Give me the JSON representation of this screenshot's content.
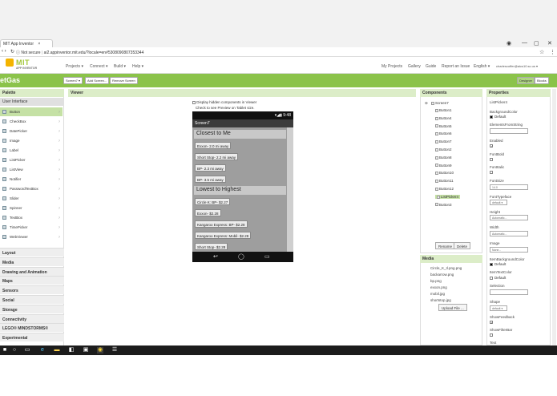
{
  "browser": {
    "tab_title": "MIT App Inventor",
    "tab_close": "×",
    "win_min": "—",
    "win_max": "▢",
    "win_close": "✕",
    "url_secure": "Not secure",
    "url": "ai2.appinventor.mit.edu/?locale=en#5308090807353344",
    "star": "☆",
    "menu": "⋮"
  },
  "appbar": {
    "logo_text": "MIT",
    "logo_sub": "APP INVENTOR",
    "menus": [
      "Projects ▾",
      "Connect ▾",
      "Build ▾",
      "Help ▾"
    ],
    "right_menus": [
      "My Projects",
      "Gallery",
      "Guide",
      "Report an Issue",
      "English ▾",
      "charlescoffer@aics10.sc.us ▾"
    ]
  },
  "toolbar": {
    "project_name": "etGas",
    "screen_btn": "Screen7 ▾",
    "add_screen": "Add Screen...",
    "remove_screen": "Remove Screen",
    "designer": "Designer",
    "blocks": "Blocks"
  },
  "palette": {
    "title": "Palette",
    "category_open": "User Interface",
    "items": [
      "Button",
      "CheckBox",
      "DatePicker",
      "Image",
      "Label",
      "ListPicker",
      "ListView",
      "Notifier",
      "PasswordTextBox",
      "Slider",
      "Spinner",
      "TextBox",
      "TimePicker",
      "WebViewer"
    ],
    "categories": [
      "Layout",
      "Media",
      "Drawing and Animation",
      "Maps",
      "Sensors",
      "Social",
      "Storage",
      "Connectivity",
      "LEGO® MINDSTORMS®",
      "Experimental"
    ]
  },
  "viewer": {
    "title": "Viewer",
    "hidden_check": "Display hidden components in Viewer",
    "preview_check": "Check to see Preview on Tablet size.",
    "status_time": "9:48",
    "screen_title": "Screen7",
    "heading1": "Closest to Me",
    "buttons1": [
      "Exxon- 2.0 mi away",
      "Short Stop- 2.2 mi away",
      "BP- 2.3 mi away",
      "BP- 3.5 mi away"
    ],
    "heading2": "Lowest to Highest",
    "buttons2": [
      "Circle K: BP- $2.27",
      "Exxon- $2.28",
      "Kangaroo Express: BP- $2.28",
      "Kangaroo Express: Mobil- $2.28",
      "Short Stop- $2.28"
    ],
    "nav_back": "↩",
    "nav_home": "◯",
    "nav_recent": "▭"
  },
  "components": {
    "title": "Components",
    "root": "Screen7",
    "items": [
      "Button1",
      "Button4",
      "Button5",
      "Button6",
      "Button7",
      "Button2",
      "Button8",
      "Button9",
      "Button10",
      "Button11",
      "Button12",
      "ListPicker4",
      "Button3"
    ],
    "selected": "ListPicker4",
    "rename": "Rename",
    "delete": "Delete"
  },
  "media": {
    "title": "Media",
    "files": [
      "Circle_K_Il.png.png",
      "backarrow.png",
      "bp.png",
      "exxon.png",
      "mobil.jpg",
      "shortstop.jpg"
    ],
    "upload": "Upload File ..."
  },
  "properties": {
    "title": "Properties",
    "component": "ListPicker4",
    "bg_label": "BackgroundColor",
    "bg_value": "Default",
    "elements_label": "ElementsFromString",
    "enabled_label": "Enabled",
    "fontbold_label": "FontBold",
    "fontitalic_label": "FontItalic",
    "fontsize_label": "FontSize",
    "fontsize_value": "14.0",
    "typeface_label": "FontTypeface",
    "typeface_value": "default ▾",
    "height_label": "Height",
    "height_value": "Automatic...",
    "width_label": "Width",
    "width_value": "Automatic...",
    "image_label": "Image",
    "image_value": "None...",
    "itembg_label": "ItemBackgroundColor",
    "itembg_value": "Default",
    "itemtext_label": "ItemTextColor",
    "itemtext_value": "Default",
    "selection_label": "Selection",
    "shape_label": "Shape",
    "shape_value": "default ▾",
    "showfeedback_label": "ShowFeedback",
    "showfilter_label": "ShowFilterBar",
    "text_label": "Text"
  },
  "colors": {
    "accent_green": "#8bc34a",
    "panel_head": "#dcedc8"
  }
}
